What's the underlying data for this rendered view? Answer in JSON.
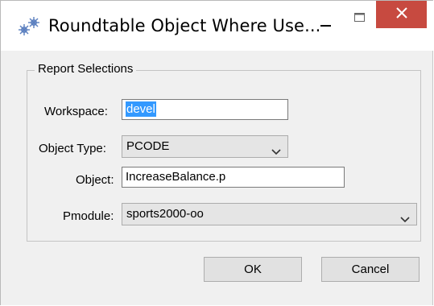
{
  "window": {
    "title": "Roundtable Object Where Use...",
    "app_icon": "roundtable-app-icon",
    "controls": {
      "minimize_icon": "minimize-icon",
      "maximize_icon": "maximize-icon",
      "close_icon": "close-icon",
      "close_color": "#c74a40"
    }
  },
  "report_selections": {
    "legend": "Report Selections",
    "workspace": {
      "label": "Workspace:",
      "value": "devel"
    },
    "object_type": {
      "label": "Object Type:",
      "selected": "PCODE"
    },
    "object": {
      "label": "Object:",
      "value": "IncreaseBalance.p"
    },
    "pmodule": {
      "label": "Pmodule:",
      "selected": "sports2000-oo"
    }
  },
  "buttons": {
    "ok_label": "OK",
    "cancel_label": "Cancel"
  },
  "colors": {
    "selection": "#3399ff",
    "dialog_bg": "#f0f0f0"
  }
}
